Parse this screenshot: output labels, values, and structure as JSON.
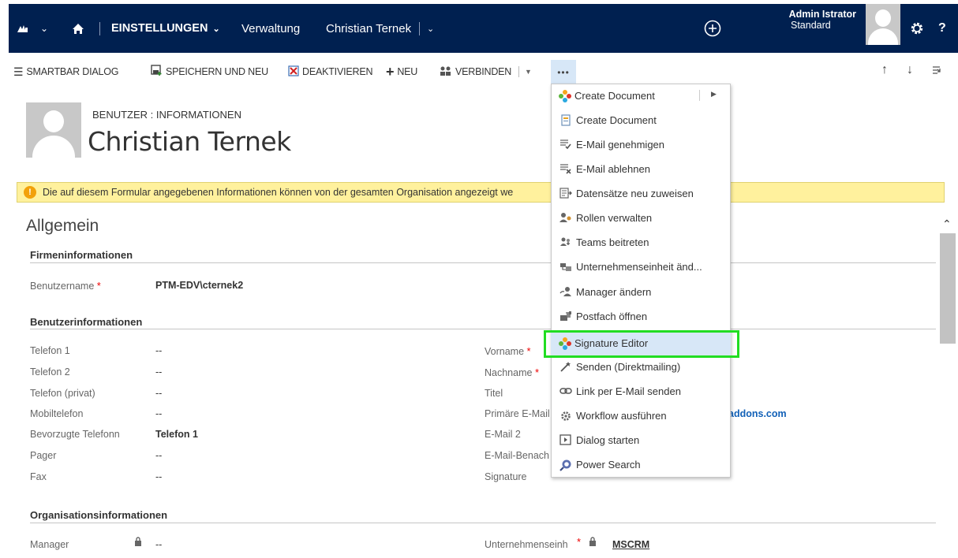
{
  "nav": {
    "logo_icon": "dynamics-logo-icon",
    "home_icon": "home-icon",
    "area": "EINSTELLUNGEN",
    "crumb1": "Verwaltung",
    "crumb2": "Christian Ternek",
    "user_name": "Admin Istrator",
    "user_role": "Standard"
  },
  "commands": {
    "smartbar": "SMARTBAR DIALOG",
    "save_new": "SPEICHERN UND NEU",
    "deactivate": "DEAKTIVIEREN",
    "new": "NEU",
    "connect": "VERBINDEN",
    "more": "•••"
  },
  "header": {
    "entity": "BENUTZER : INFORMATIONEN",
    "name": "Christian Ternek"
  },
  "notification": "Die auf diesem Formular angegebenen Informationen können von der gesamten Organisation angezeigt we",
  "form": {
    "tab_title": "Allgemein",
    "section1": "Firmeninformationen",
    "username_label": "Benutzername",
    "username_value": "PTM-EDV\\cternek2",
    "section2": "Benutzerinformationen",
    "left_fields": [
      {
        "label": "Telefon 1",
        "value": "--"
      },
      {
        "label": "Telefon 2",
        "value": "--"
      },
      {
        "label": "Telefon (privat)",
        "value": "--"
      },
      {
        "label": "Mobiltelefon",
        "value": "--"
      },
      {
        "label": "Bevorzugte Telefonn",
        "value": "Telefon 1"
      },
      {
        "label": "Pager",
        "value": "--"
      },
      {
        "label": "Fax",
        "value": "--"
      }
    ],
    "right_fields": [
      {
        "label": "Vorname"
      },
      {
        "label": "Nachname"
      },
      {
        "label": "Titel"
      },
      {
        "label": "Primäre E-Mail",
        "value": "addons.com"
      },
      {
        "label": "E-Mail 2"
      },
      {
        "label": "E-Mail-Benach"
      },
      {
        "label": "Signature"
      }
    ],
    "section3": "Organisationsinformationen",
    "manager_label": "Manager",
    "manager_value": "--",
    "bu_label": "Unternehmenseinh",
    "bu_value": "MSCRM"
  },
  "menu": [
    {
      "label": "Create Document",
      "icon": "pinwheel-icon"
    },
    {
      "label": "Create Document",
      "icon": "document-icon"
    },
    {
      "label": "E-Mail genehmigen",
      "icon": "email-approve-icon"
    },
    {
      "label": "E-Mail ablehnen",
      "icon": "email-reject-icon"
    },
    {
      "label": "Datensätze neu zuweisen",
      "icon": "reassign-icon"
    },
    {
      "label": "Rollen verwalten",
      "icon": "roles-icon"
    },
    {
      "label": "Teams beitreten",
      "icon": "teams-icon"
    },
    {
      "label": "Unternehmenseinheit änd...",
      "icon": "business-unit-icon"
    },
    {
      "label": "Manager ändern",
      "icon": "manager-icon"
    },
    {
      "label": "Postfach öffnen",
      "icon": "mailbox-icon"
    },
    {
      "label": "Signature Editor",
      "icon": "pinwheel-icon"
    },
    {
      "label": "Senden (Direktmailing)",
      "icon": "wand-icon"
    },
    {
      "label": "Link per E-Mail senden",
      "icon": "link-icon"
    },
    {
      "label": "Workflow ausführen",
      "icon": "workflow-icon"
    },
    {
      "label": "Dialog starten",
      "icon": "dialog-icon"
    },
    {
      "label": "Power Search",
      "icon": "power-search-icon"
    }
  ],
  "colors": {
    "nav_bg": "#002050",
    "highlight": "#d7e7f7",
    "notification": "#fff19d",
    "green_outline": "#22dd22"
  }
}
